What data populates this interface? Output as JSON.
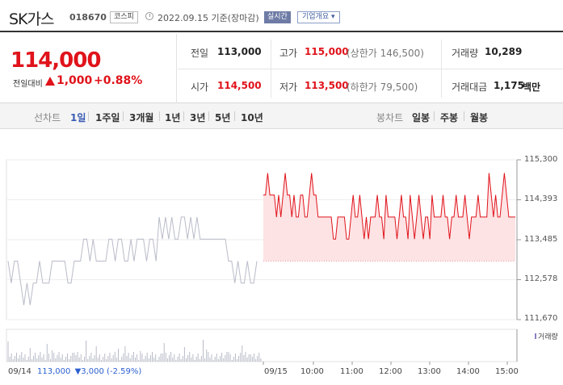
{
  "header": {
    "stock_name": "SK가스",
    "stock_code": "018670",
    "market": "코스피",
    "as_of": "2022.09.15 기준(장마감)",
    "realtime_label": "실시간",
    "company_overview": "기업개요"
  },
  "summary": {
    "price": "114,000",
    "change_label": "전일대비",
    "change_value": "1,000",
    "change_rate": "+0.88%",
    "prev_close_label": "전일",
    "prev_close": "113,000",
    "open_label": "시가",
    "open": "114,500",
    "high_label": "고가",
    "high": "115,000",
    "upper_limit": "(상한가 146,500)",
    "low_label": "저가",
    "low": "113,500",
    "lower_limit": "(하한가 79,500)",
    "volume_label": "거래량",
    "volume": "10,289",
    "value_label": "거래대금",
    "value": "1,175",
    "value_unit": "백만"
  },
  "period_bar": {
    "line_label": "선차트",
    "line_periods": [
      "1일",
      "1주일",
      "3개월",
      "1년",
      "3년",
      "5년",
      "10년"
    ],
    "selected": "1일",
    "candle_label": "봉차트",
    "candle_periods": [
      "일봉",
      "주봉",
      "월봉"
    ]
  },
  "footer": {
    "prev_date": "09/14",
    "prev_price": "113,000",
    "prev_change": "▼3,000 (-2.59%)"
  },
  "chart_data": {
    "type": "line",
    "title": "",
    "y_ticks": [
      "115,300",
      "114,393",
      "113,485",
      "112,578",
      "111,670"
    ],
    "ylim": [
      111670,
      115300
    ],
    "x_ticks": [
      "09/14",
      "09/15",
      "10:00",
      "11:00",
      "12:00",
      "13:00",
      "14:00",
      "15:00"
    ],
    "reference_price": 113000,
    "volume_label": "거래량",
    "series": [
      {
        "name": "09/14",
        "values": [
          113000,
          112500,
          113000,
          113000,
          112500,
          112000,
          112500,
          112000,
          112500,
          112500,
          113000,
          112500,
          112500,
          112500,
          113000,
          113000,
          113000,
          113000,
          113000,
          112500,
          112500,
          113000,
          113000,
          113000,
          113500,
          113500,
          113000,
          113500,
          113000,
          113000,
          113000,
          113000,
          113500,
          113500,
          113000,
          113500,
          113500,
          113000,
          113000,
          113500,
          113000,
          113500,
          113500,
          113500,
          113000,
          113500,
          113500,
          113000,
          114000,
          113500,
          114000,
          113500,
          114000,
          113500,
          113500,
          114000,
          114000,
          113500,
          114000,
          113500,
          114000,
          113500,
          113500,
          113500,
          113500,
          113500,
          113500,
          113500,
          113500,
          113500,
          113000,
          113000,
          112500,
          113000,
          112500,
          112500,
          113000,
          112500,
          112500,
          113000
        ]
      },
      {
        "name": "09/15",
        "values": [
          114500,
          114500,
          115000,
          114500,
          114500,
          114500,
          114000,
          114500,
          114000,
          114500,
          115000,
          114500,
          114500,
          114000,
          114500,
          114000,
          114000,
          114500,
          114500,
          114000,
          114000,
          114500,
          115000,
          114500,
          114500,
          114000,
          114000,
          114000,
          114000,
          114000,
          114000,
          114000,
          113500,
          113500,
          114000,
          114000,
          114000,
          114000,
          113500,
          113500,
          114000,
          114500,
          114000,
          114000,
          114500,
          114000,
          113500,
          114000,
          113500,
          114000,
          114000,
          114000,
          114500,
          114000,
          114000,
          113500,
          114500,
          114000,
          114000,
          114000,
          114000,
          113500,
          114000,
          114500,
          114000,
          114000,
          113500,
          114500,
          114000,
          113500,
          114000,
          114500,
          114000,
          113500,
          114000,
          114000,
          113500,
          114500,
          114000,
          114000,
          114000,
          114000,
          114500,
          114000,
          114000,
          113500,
          114000,
          114000,
          114500,
          114000,
          114000,
          114000,
          114500,
          114000,
          113500,
          114000,
          114000,
          114000,
          114500,
          114000,
          114000,
          114000,
          114000,
          115000,
          114500,
          114000,
          114500,
          114000,
          114000,
          114500,
          115000,
          114500,
          114000,
          114000,
          114000,
          114000
        ]
      }
    ]
  },
  "colors": {
    "up": "#e0131b",
    "down": "#2a5fcf",
    "prev_line": "#b8bcc8",
    "fill": "#fde3e4",
    "volume": "#8a7fc9"
  }
}
